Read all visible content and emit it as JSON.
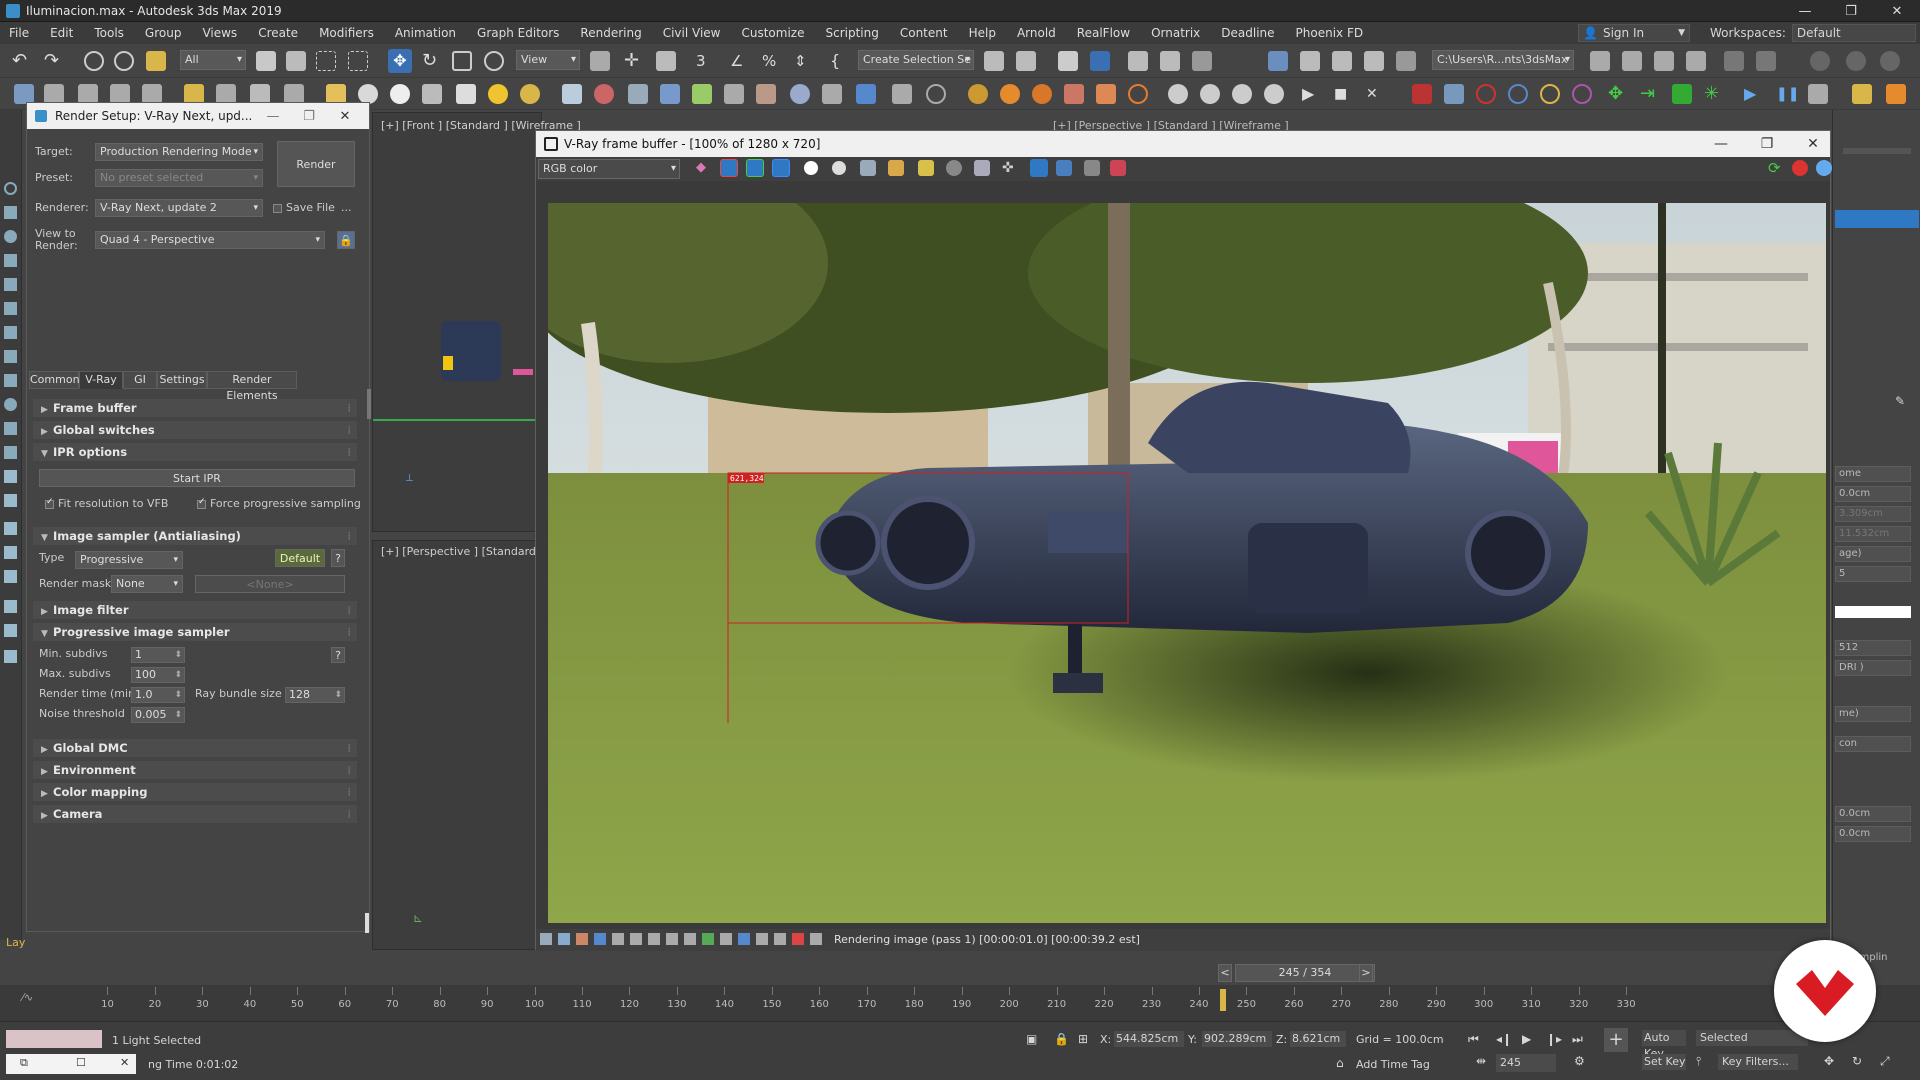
{
  "window": {
    "title": "Iluminacion.max - Autodesk 3ds Max 2019",
    "minimize": "—",
    "maximize": "❐",
    "close": "✕"
  },
  "menu": {
    "items": [
      "File",
      "Edit",
      "Tools",
      "Group",
      "Views",
      "Create",
      "Modifiers",
      "Animation",
      "Graph Editors",
      "Rendering",
      "Civil View",
      "Customize",
      "Scripting",
      "Content",
      "Help",
      "Arnold",
      "RealFlow",
      "Ornatrix",
      "Deadline",
      "Phoenix FD"
    ],
    "sign_in": "Sign In",
    "workspaces_label": "Workspaces:",
    "workspaces_value": "Default"
  },
  "toolbar": {
    "filter_value": "All",
    "view_value": "View",
    "selection_set": "Create Selection Se",
    "path_value": "C:\\Users\\R...nts\\3dsMax"
  },
  "render_setup": {
    "title": "Render Setup: V-Ray Next, upd...",
    "target_label": "Target:",
    "target_value": "Production Rendering Mode",
    "preset_label": "Preset:",
    "preset_value": "No preset selected",
    "renderer_label": "Renderer:",
    "renderer_value": "V-Ray Next, update 2",
    "save_file": "Save File",
    "more": "...",
    "view_label_1": "View to",
    "view_label_2": "Render:",
    "view_value": "Quad 4 - Perspective",
    "render_button": "Render",
    "tabs": [
      "Common",
      "V-Ray",
      "GI",
      "Settings",
      "Render Elements"
    ],
    "rollouts": {
      "frame_buffer": "Frame buffer",
      "global_switches": "Global switches",
      "ipr_options": "IPR options",
      "image_sampler": "Image sampler (Antialiasing)",
      "image_filter": "Image filter",
      "progressive": "Progressive image sampler",
      "global_dmc": "Global DMC",
      "environment": "Environment",
      "color_mapping": "Color mapping",
      "camera": "Camera"
    },
    "start_ipr": "Start IPR",
    "fit_resolution": "Fit resolution to VFB",
    "force_progressive": "Force progressive sampling",
    "type_label": "Type",
    "type_value": "Progressive",
    "default_button": "Default",
    "help": "?",
    "render_mask_label": "Render mask",
    "render_mask_value": "None",
    "render_mask_none": "<None>",
    "min_subdivs_label": "Min. subdivs",
    "min_subdivs": "1",
    "max_subdivs_label": "Max. subdivs",
    "max_subdivs": "100",
    "render_time_label": "Render time (min)",
    "render_time": "1.0",
    "ray_bundle_label": "Ray bundle size",
    "ray_bundle": "128",
    "noise_label": "Noise threshold",
    "noise": "0.005"
  },
  "viewports": {
    "front": "[+] [Front ] [Standard ] [Wireframe ]",
    "perspective_top": "[+] [Perspective ] [Standard ] [Wireframe ]",
    "perspective_bottom": "[+] [Perspective ] [Standard ]"
  },
  "vfb": {
    "title": "V-Ray frame buffer - [100% of 1280 x 720]",
    "channel": "RGB color",
    "region_label": "621,324",
    "status": "Rendering image (pass 1) [00:00:01.0] [00:00:39.2 est]"
  },
  "timeline": {
    "slider": "245 / 354",
    "prev": "<",
    "next": ">",
    "ticks": [
      "10",
      "20",
      "30",
      "40",
      "50",
      "60",
      "70",
      "80",
      "90",
      "100",
      "110",
      "120",
      "130",
      "140",
      "150",
      "160",
      "170",
      "180",
      "190",
      "200",
      "210",
      "220",
      "230",
      "240",
      "250",
      "260",
      "270",
      "280",
      "290",
      "300",
      "310",
      "320",
      "330"
    ],
    "current_frame": 245,
    "total_frames": 354
  },
  "status_bar": {
    "selection": "1 Light Selected",
    "render_time": "ng Time  0:01:02",
    "layer": "Lay",
    "x_label": "X:",
    "x_value": "544.825cm",
    "y_label": "Y:",
    "y_value": "902.289cm",
    "z_label": "Z:",
    "z_value": "8.621cm",
    "grid": "Grid = 100.0cm",
    "add_time_tag": "Add Time Tag",
    "auto_key": "Auto Key",
    "selected": "Selected",
    "set_key": "Set Key",
    "key_filters": "Key Filters...",
    "frame_field": "245"
  },
  "right_panel": {
    "f1": "ome",
    "f2": "0.0cm",
    "f3": "3.309cm",
    "f4": "11.532cm",
    "f5": "age)",
    "f6": "5",
    "f7": "512",
    "f8": "DRI )",
    "f9": "me)",
    "f10": "con",
    "f11": "0.0cm",
    "f12": "0.0cm",
    "f13": "Samplin"
  },
  "colors": {
    "accent": "#2f78c4",
    "logo_red": "#d91c24",
    "region_red": "#cc2222"
  }
}
